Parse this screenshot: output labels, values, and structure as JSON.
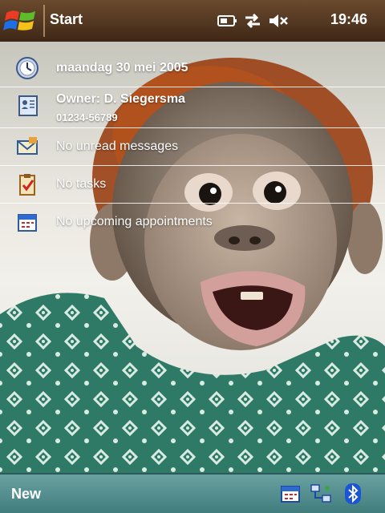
{
  "titlebar": {
    "title": "Start",
    "time": "19:46",
    "status_icons": [
      "signal-icon",
      "connectivity-icon",
      "volume-mute-icon"
    ]
  },
  "today": {
    "date": "maandag 30 mei 2005",
    "owner_name": "Owner: D. Siegersma",
    "owner_phone": "01234-56789",
    "messages": "No unread messages",
    "tasks": "No tasks",
    "appointments": "No upcoming appointments"
  },
  "menubar": {
    "new_label": "New",
    "tray_icons": [
      "calendar-icon",
      "network-icon",
      "bluetooth-icon"
    ]
  },
  "colors": {
    "titlebar": "#5a3b22",
    "menubar": "#4f8b8b",
    "accent_blue": "#1a55d8"
  }
}
